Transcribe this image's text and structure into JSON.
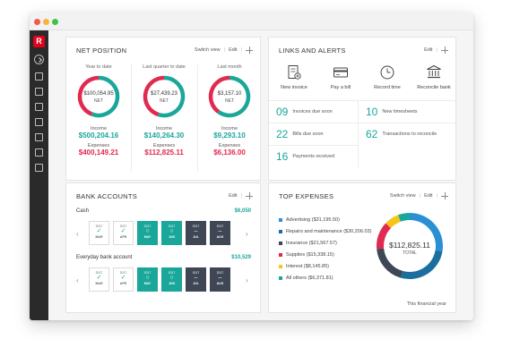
{
  "app": {
    "logo_letter": "R"
  },
  "net_position": {
    "title": "NET POSITION",
    "switch_view": "Switch view",
    "edit": "Edit",
    "columns": [
      {
        "period": "Year to date",
        "net": "$100,054.95",
        "net_label": "NET",
        "income_label": "Income",
        "income": "$500,204.16",
        "expenses_label": "Expenses",
        "expenses": "$400,149.21",
        "income_share": 0.56
      },
      {
        "period": "Last quarter to date",
        "net": "$27,439.23",
        "net_label": "NET",
        "income_label": "Income",
        "income": "$140,264.30",
        "expenses_label": "Expenses",
        "expenses": "$112,825.11",
        "income_share": 0.55
      },
      {
        "period": "Last month",
        "net": "$3,157.10",
        "net_label": "NET",
        "income_label": "Income",
        "income": "$9,293.10",
        "expenses_label": "Expenses",
        "expenses": "$6,136.00",
        "income_share": 0.6
      }
    ],
    "colors": {
      "income": "#1aa79a",
      "expenses": "#e2294f"
    }
  },
  "links_alerts": {
    "title": "LINKS AND ALERTS",
    "edit": "Edit",
    "actions": [
      {
        "label": "New invoice",
        "icon": "invoice-icon"
      },
      {
        "label": "Pay a bill",
        "icon": "card-icon"
      },
      {
        "label": "Record time",
        "icon": "clock-icon"
      },
      {
        "label": "Reconcile bank",
        "icon": "bank-icon"
      }
    ],
    "alerts": [
      {
        "count": "09",
        "label": "Invoices due soon"
      },
      {
        "count": "10",
        "label": "New timesheets"
      },
      {
        "count": "22",
        "label": "Bills due soon"
      },
      {
        "count": "62",
        "label": "Transactions to reconcile"
      },
      {
        "count": "16",
        "label": "Payments received"
      }
    ]
  },
  "bank_accounts": {
    "title": "BANK ACCOUNTS",
    "edit": "Edit",
    "accounts": [
      {
        "name": "Cash",
        "amount": "$6,050",
        "months": [
          {
            "year": "2017",
            "month": "MAR",
            "status": "check",
            "style": "white"
          },
          {
            "year": "2017",
            "month": "APR",
            "status": "check",
            "style": "white"
          },
          {
            "year": "2017",
            "month": "MAY",
            "status": "circle",
            "style": "teal"
          },
          {
            "year": "2017",
            "month": "JUN",
            "status": "circle",
            "style": "teal"
          },
          {
            "year": "2017",
            "month": "JUL",
            "status": "dash",
            "style": "dark"
          },
          {
            "year": "2017",
            "month": "AUG",
            "status": "dash",
            "style": "dark"
          }
        ]
      },
      {
        "name": "Everyday bank account",
        "amount": "$10,529",
        "months": [
          {
            "year": "2017",
            "month": "MAR",
            "status": "check",
            "style": "white"
          },
          {
            "year": "2017",
            "month": "APR",
            "status": "check",
            "style": "white"
          },
          {
            "year": "2017",
            "month": "MAY",
            "status": "circle",
            "style": "teal"
          },
          {
            "year": "2017",
            "month": "JUN",
            "status": "circle",
            "style": "teal"
          },
          {
            "year": "2017",
            "month": "JUL",
            "status": "dash",
            "style": "dark"
          },
          {
            "year": "2017",
            "month": "AUG",
            "status": "dash",
            "style": "dark"
          }
        ]
      }
    ]
  },
  "top_expenses": {
    "title": "TOP EXPENSES",
    "switch_view": "Switch view",
    "edit": "Edit",
    "total": "$112,825.11",
    "total_label": "TOTAL",
    "footer": "This financial year",
    "items": [
      {
        "label": "Advertising ($31,195.50)",
        "value": 31195.5,
        "color": "#2b8fd6"
      },
      {
        "label": "Repairs and maintenance ($30,206.03)",
        "value": 30206.03,
        "color": "#1b6e9e"
      },
      {
        "label": "Insurance ($21,567.57)",
        "value": 21567.57,
        "color": "#3e4753"
      },
      {
        "label": "Supplies ($15,338.15)",
        "value": 15338.15,
        "color": "#e2294f"
      },
      {
        "label": "Interest ($8,145.85)",
        "value": 8145.85,
        "color": "#f5c518"
      },
      {
        "label": "All others ($6,371.81)",
        "value": 6371.81,
        "color": "#1aa79a"
      }
    ]
  }
}
